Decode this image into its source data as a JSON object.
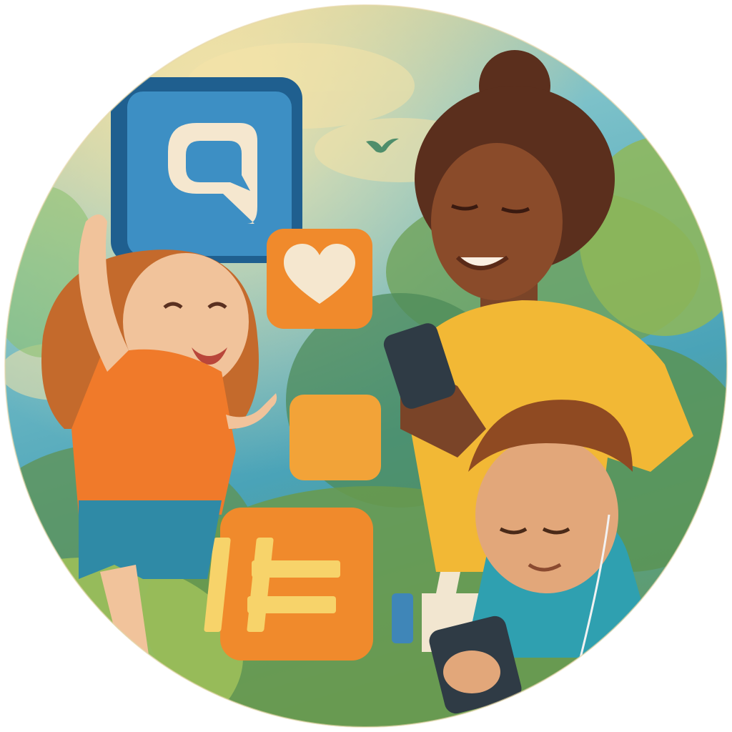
{
  "scene": {
    "frame_shape": "circle",
    "style": "painted illustration",
    "colors": {
      "sky_top": "#f3d58a",
      "sky_mid": "#7cc1c9",
      "sky_low": "#4aa3b8",
      "foliage_dark": "#4d8b5a",
      "foliage_light": "#9cbf5a",
      "chat_tile": "#3d8fc4",
      "chat_tile_dark": "#1f5f8f",
      "orange_tile": "#f08a2c",
      "amber_tile": "#f2a338",
      "tile_symbol_cream": "#f5e7cf",
      "hash_symbol": "#f7d36a",
      "thumb_cream": "#f2e6d0",
      "thumb_blue": "#3f86b8"
    },
    "icons": [
      "chat-bubble-icon",
      "heart-icon",
      "blank-tile-icon",
      "hashtag-icon",
      "thumbs-up-icon"
    ],
    "figures": [
      "dancing-girl",
      "smiling-girl-with-phone",
      "boy-with-earphones-and-phone"
    ]
  }
}
